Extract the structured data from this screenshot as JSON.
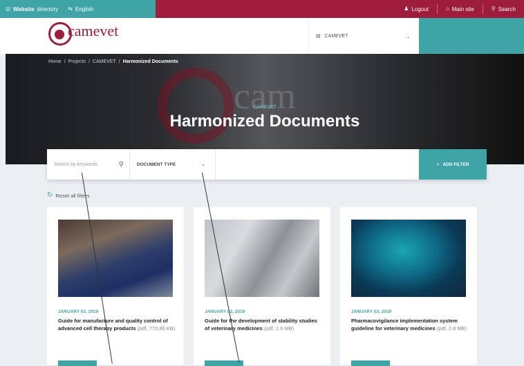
{
  "topbar": {
    "language": "English",
    "left_item": "Website",
    "left_item_suffix": "directory",
    "logout": "Logout",
    "main_site": "Main site",
    "search": "Search"
  },
  "header": {
    "logo_text": "camevet",
    "project_select": "CAMEVET"
  },
  "hero": {
    "breadcrumb": [
      "Home",
      "Projects",
      "CAMEVET"
    ],
    "breadcrumb_current": "Harmonized Documents",
    "kicker": "CAMEVET",
    "title": "Harmonized Documents"
  },
  "filters": {
    "search_placeholder": "Search by keywords",
    "doc_type": "DOCUMENT TYPE",
    "add_filter": "ADD FILTER",
    "reset": "Reset all filters"
  },
  "cards": [
    {
      "date": "JANUARY 03, 2019",
      "title": "Guide for manufacture and quality control of advanced cell therapy products",
      "meta": "(pdf, 770.86 KB)"
    },
    {
      "date": "JANUARY 03, 2019",
      "title": "Guide for the development of stability studies of veterinary medicines",
      "meta": "(pdf, 1.6 MB)"
    },
    {
      "date": "JANUARY 03, 2019",
      "title": "Pharmacovigilance implementation system guideline for veterinary medicines",
      "meta": "(pdf, 2.8 MB)"
    }
  ],
  "colors": {
    "teal": "#3ea4a6",
    "brand": "#9e1c3c"
  }
}
